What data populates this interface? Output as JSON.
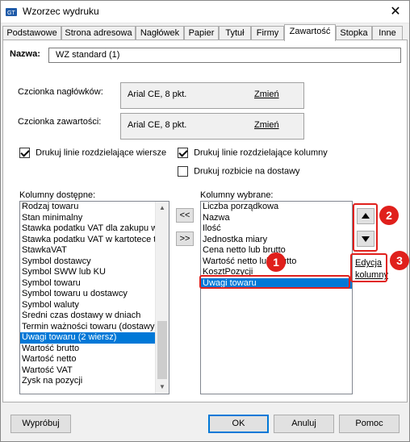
{
  "window": {
    "title": "Wzorzec wydruku",
    "close_glyph": "✕"
  },
  "tabs": [
    {
      "label": "Podstawowe"
    },
    {
      "label": "Strona adresowa"
    },
    {
      "label": "Nagłówek"
    },
    {
      "label": "Papier"
    },
    {
      "label": "Tytuł"
    },
    {
      "label": "Firmy"
    },
    {
      "label": "Zawartość",
      "active": true
    },
    {
      "label": "Stopka"
    },
    {
      "label": "Inne"
    }
  ],
  "name_field": {
    "label": "Nazwa:",
    "value": "WZ standard (1)"
  },
  "fonts": {
    "header": {
      "label": "Czcionka nagłówków:",
      "value": "Arial CE, 8 pkt.",
      "change": "Zmień"
    },
    "content": {
      "label": "Czcionka zawartości:",
      "value": "Arial CE, 8 pkt.",
      "change": "Zmień"
    }
  },
  "checkboxes": {
    "row_lines": {
      "label": "Drukuj linie rozdzielające wiersze",
      "checked": true
    },
    "col_lines": {
      "label": "Drukuj linie rozdzielające kolumny",
      "checked": true
    },
    "split_delivery": {
      "label": "Drukuj rozbicie na dostawy",
      "checked": false
    }
  },
  "available": {
    "label": "Kolumny dostępne:",
    "items": [
      "Rodzaj towaru",
      "Stan minimalny",
      "Stawka podatku VAT dla zakupu w",
      "Stawka podatku VAT w kartotece t",
      "StawkaVAT",
      "Symbol dostawcy",
      "Symbol SWW lub KU",
      "Symbol towaru",
      "Symbol towaru u dostawcy",
      "Symbol waluty",
      "Średni czas dostawy w dniach",
      "Termin ważności towaru (dostawy)",
      "Uwagi towaru (2 wiersz)",
      "Wartość brutto",
      "Wartość netto",
      "Wartość VAT",
      "Zysk na pozycji"
    ],
    "selected_index": 12
  },
  "move_buttons": {
    "left": "<<",
    "right": ">>"
  },
  "selected": {
    "label": "Kolumny wybrane:",
    "items": [
      "Liczba porządkowa",
      "Nazwa",
      "Ilość",
      "Jednostka miary",
      "Cena netto lub brutto",
      "Wartość netto lub brutto",
      "KosztPozycji",
      "Uwagi towaru"
    ],
    "selected_index": 7
  },
  "column_edit": {
    "line1": "Edycja",
    "line2": "kolumny"
  },
  "annotations": {
    "badge1": "1",
    "badge2": "2",
    "badge3": "3",
    "color": "#e0201c"
  },
  "footer": {
    "test": "Wypróbuj",
    "ok": "OK",
    "cancel": "Anuluj",
    "help": "Pomoc"
  },
  "colors": {
    "selection": "#0078d7",
    "dialog_bg": "#f0f0f0"
  }
}
